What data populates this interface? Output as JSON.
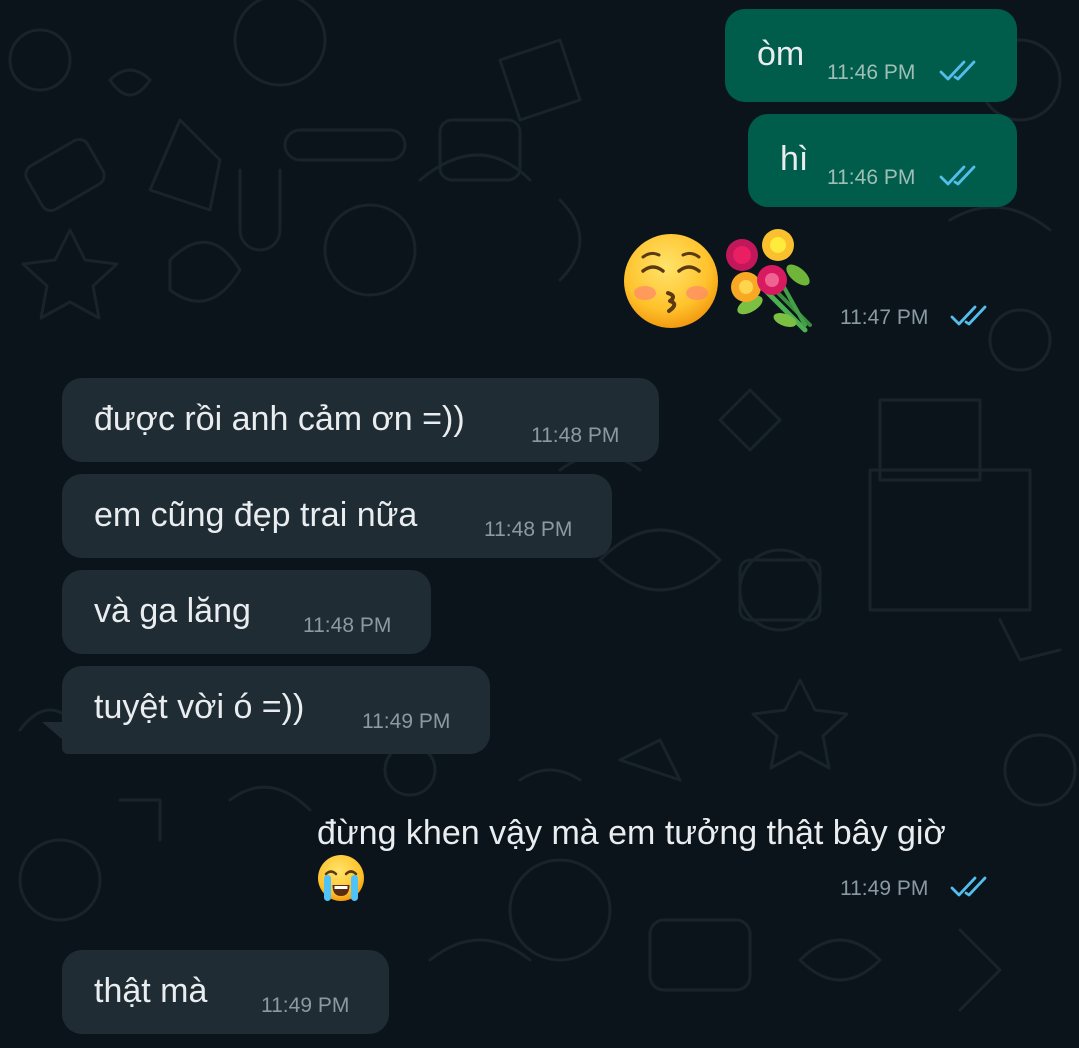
{
  "colors": {
    "background": "#0b141a",
    "outgoing_bubble": "#005c4b",
    "incoming_bubble": "#202c33",
    "text": "#e9edef",
    "read_ticks": "#53bdeb"
  },
  "messages": [
    {
      "direction": "outgoing",
      "text": "òm",
      "time": "11:46 PM",
      "status": "read"
    },
    {
      "direction": "outgoing",
      "text": "hì",
      "time": "11:46 PM",
      "status": "read"
    },
    {
      "direction": "outgoing",
      "type": "emoji",
      "emojis": [
        "kissing-face-with-closed-eyes",
        "bouquet"
      ],
      "time": "11:47 PM",
      "status": "read"
    },
    {
      "direction": "incoming",
      "text": "được rồi anh cảm ơn =))",
      "time": "11:48 PM"
    },
    {
      "direction": "incoming",
      "text": "em cũng đẹp trai nữa",
      "time": "11:48 PM"
    },
    {
      "direction": "incoming",
      "text": "và ga lăng",
      "time": "11:48 PM"
    },
    {
      "direction": "incoming",
      "text": "tuyệt vời ó =))",
      "time": "11:49 PM"
    },
    {
      "direction": "outgoing",
      "text": "đừng khen vậy mà em tưởng thật bây giờ",
      "emoji": "loudly-crying-face",
      "time": "11:49 PM",
      "status": "read"
    },
    {
      "direction": "incoming",
      "text": "thật mà",
      "time": "11:49 PM"
    }
  ]
}
